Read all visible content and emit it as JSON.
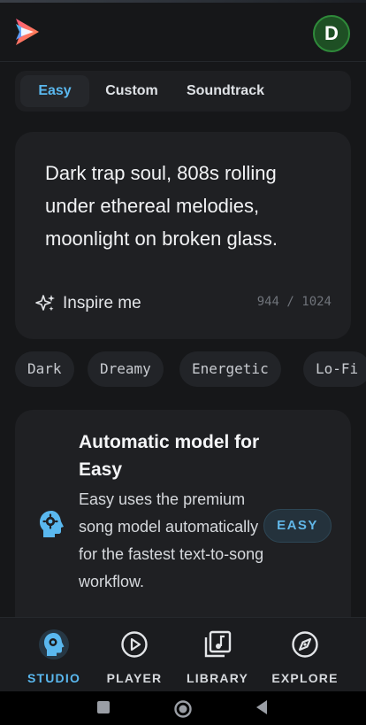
{
  "header": {
    "logo_icon": "play-arrow-logo-icon",
    "avatar_initial": "D"
  },
  "modes": {
    "items": [
      {
        "label": "Easy",
        "active": true
      },
      {
        "label": "Custom",
        "active": false
      },
      {
        "label": "Soundtrack",
        "active": false
      }
    ]
  },
  "prompt": {
    "text": "Dark trap soul, 808s rolling under ethereal melodies, moonlight on broken glass.",
    "inspire_label": "Inspire me",
    "inspire_icon": "sparkles-icon",
    "counter": "944 / 1024"
  },
  "chips": {
    "items": [
      "Dark",
      "Dreamy",
      "Energetic",
      "Lo-Fi"
    ]
  },
  "info_card": {
    "icon": "head-gear-icon",
    "title": "Automatic model for Easy",
    "description": "Easy uses the premium song model automatically for the fastest text-to-song workflow.",
    "badge": "EASY"
  },
  "bottom_nav": {
    "items": [
      {
        "label": "STUDIO",
        "icon": "head-gear-icon",
        "active": true
      },
      {
        "label": "PLAYER",
        "icon": "play-circle-icon",
        "active": false
      },
      {
        "label": "LIBRARY",
        "icon": "music-library-icon",
        "active": false
      },
      {
        "label": "EXPLORE",
        "icon": "compass-icon",
        "active": false
      }
    ]
  },
  "colors": {
    "accent": "#5ab8ef",
    "background": "#161719",
    "card": "#1f2023",
    "avatar": "#1e4f24"
  }
}
